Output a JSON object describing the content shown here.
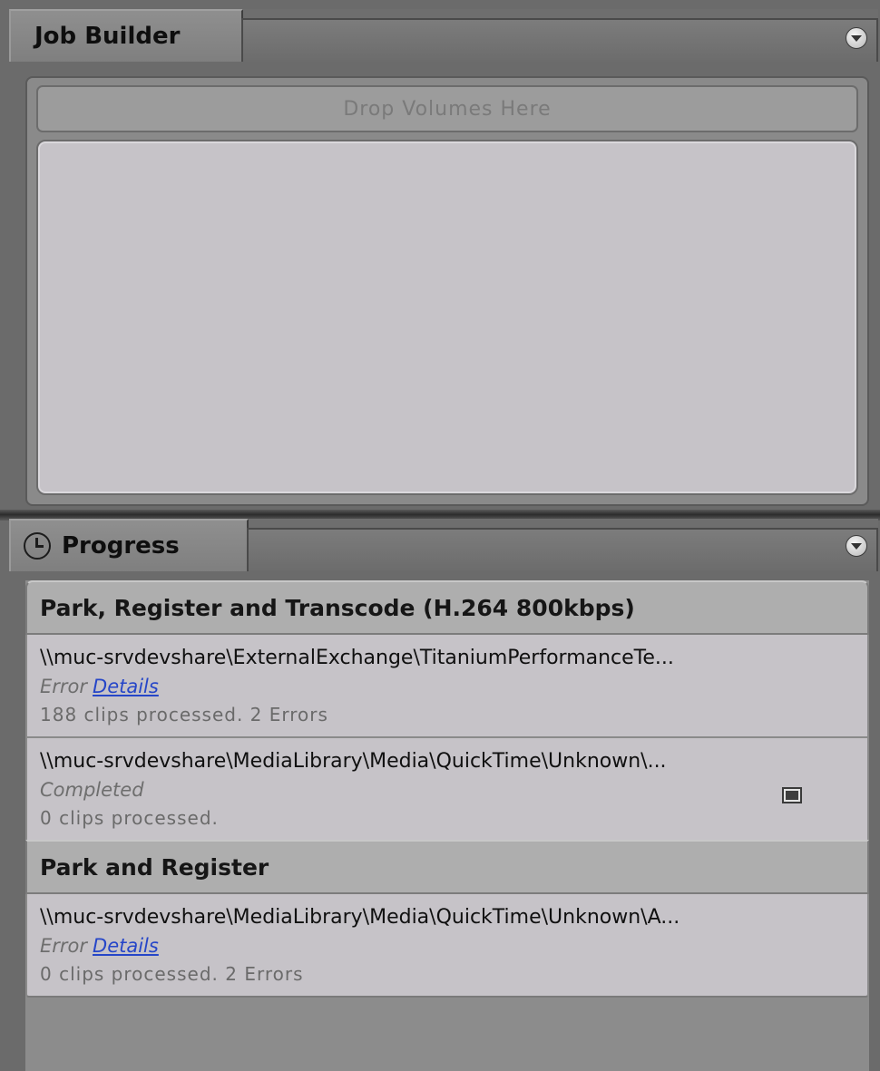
{
  "job_builder": {
    "tab_label": "Job Builder",
    "drop_label": "Drop Volumes Here"
  },
  "progress": {
    "tab_label": "Progress",
    "groups": [
      {
        "title": "Park, Register and Transcode (H.264 800kbps)",
        "items": [
          {
            "path": "\\\\muc-srvdevshare\\ExternalExchange\\TitaniumPerformanceTe...",
            "status": "Error",
            "details_label": "Details",
            "summary": "188 clips processed. 2 Errors"
          },
          {
            "path": "\\\\muc-srvdevshare\\MediaLibrary\\Media\\QuickTime\\Unknown\\...",
            "status": "Completed",
            "summary": "0 clips processed."
          }
        ]
      },
      {
        "title": "Park and Register",
        "items": [
          {
            "path": "\\\\muc-srvdevshare\\MediaLibrary\\Media\\QuickTime\\Unknown\\A...",
            "status": "Error",
            "details_label": "Details",
            "summary": "0 clips processed. 2 Errors"
          }
        ]
      }
    ]
  },
  "icons": [
    "panel-menu-icon",
    "clock-icon",
    "preview-icon"
  ]
}
